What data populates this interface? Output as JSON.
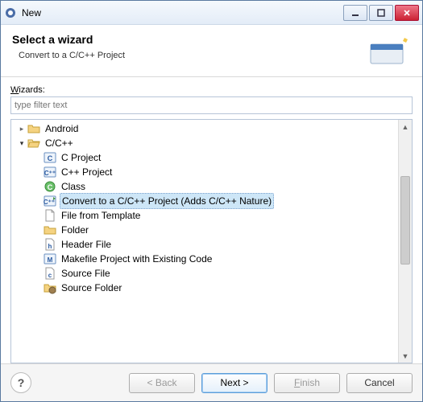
{
  "window": {
    "title": "New"
  },
  "header": {
    "title": "Select a wizard",
    "subtitle": "Convert to a C/C++ Project"
  },
  "body": {
    "wizards_label": "Wizards:",
    "filter_placeholder": "type filter text"
  },
  "tree": {
    "items": [
      {
        "label": "Android",
        "depth": 0,
        "icon": "folder-closed-icon",
        "caret": "collapsed",
        "selected": false
      },
      {
        "label": "C/C++",
        "depth": 0,
        "icon": "folder-open-icon",
        "caret": "expanded",
        "selected": false
      },
      {
        "label": "C Project",
        "depth": 1,
        "icon": "c-project-icon",
        "caret": "none",
        "selected": false
      },
      {
        "label": "C++ Project",
        "depth": 1,
        "icon": "cpp-project-icon",
        "caret": "none",
        "selected": false
      },
      {
        "label": "Class",
        "depth": 1,
        "icon": "class-icon",
        "caret": "none",
        "selected": false
      },
      {
        "label": "Convert to a C/C++ Project (Adds C/C++ Nature)",
        "depth": 1,
        "icon": "cpp-convert-icon",
        "caret": "none",
        "selected": true
      },
      {
        "label": "File from Template",
        "depth": 1,
        "icon": "file-template-icon",
        "caret": "none",
        "selected": false
      },
      {
        "label": "Folder",
        "depth": 1,
        "icon": "folder-closed-icon",
        "caret": "none",
        "selected": false
      },
      {
        "label": "Header File",
        "depth": 1,
        "icon": "header-file-icon",
        "caret": "none",
        "selected": false
      },
      {
        "label": "Makefile Project with Existing Code",
        "depth": 1,
        "icon": "makefile-icon",
        "caret": "none",
        "selected": false
      },
      {
        "label": "Source File",
        "depth": 1,
        "icon": "source-file-icon",
        "caret": "none",
        "selected": false
      },
      {
        "label": "Source Folder",
        "depth": 1,
        "icon": "source-folder-icon",
        "caret": "none",
        "selected": false
      }
    ]
  },
  "footer": {
    "back": "< Back",
    "next": "Next >",
    "finish": "Finish",
    "cancel": "Cancel"
  }
}
